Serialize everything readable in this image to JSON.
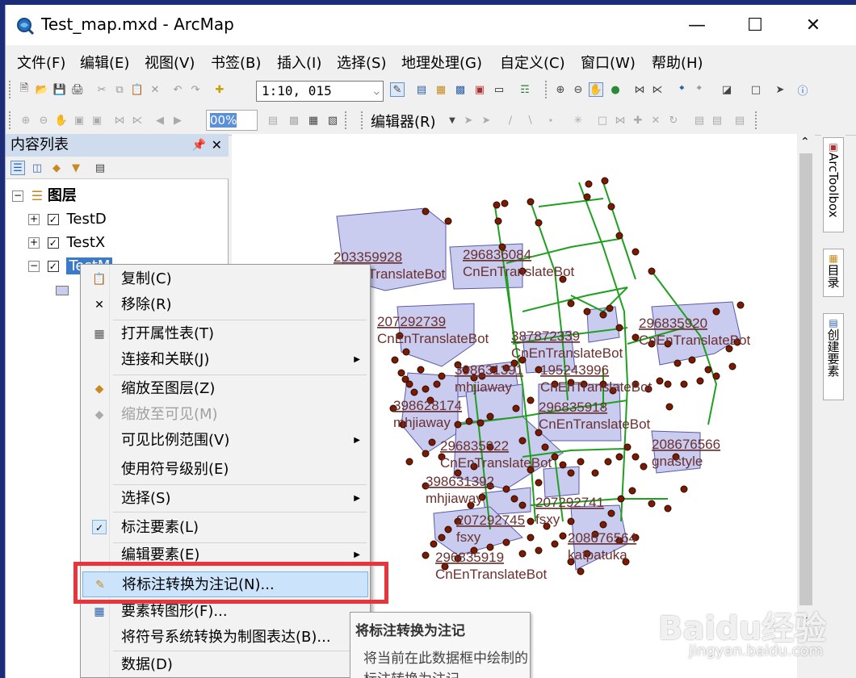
{
  "window": {
    "title": "Test_map.mxd - ArcMap"
  },
  "menubar": [
    "文件(F)",
    "编辑(E)",
    "视图(V)",
    "书签(B)",
    "插入(I)",
    "选择(S)",
    "地理处理(G)",
    "自定义(C)",
    "窗口(W)",
    "帮助(H)"
  ],
  "toolbar": {
    "scale": "1:10, 015",
    "zoom_percent": "00%",
    "editor_label": "编辑器(R)"
  },
  "toc": {
    "title": "内容列表",
    "root_label": "图层",
    "layers": [
      "TestD",
      "TestX",
      "TestM"
    ]
  },
  "side_tabs": [
    "ArcToolbox",
    "目录",
    "创建要素"
  ],
  "context_menu": {
    "items": [
      {
        "label": "复制(C)",
        "icon": "copy-icon"
      },
      {
        "label": "移除(R)",
        "icon": "remove-icon"
      },
      {
        "label": "打开属性表(T)",
        "icon": "table-icon"
      },
      {
        "label": "连接和关联(J)"
      },
      {
        "label": "缩放至图层(Z)",
        "icon": "zoom-layer-icon"
      },
      {
        "label": "缩放至可见(M)",
        "icon": "zoom-visible-icon"
      },
      {
        "label": "可见比例范围(V)"
      },
      {
        "label": "使用符号级别(E)"
      },
      {
        "label": "选择(S)"
      },
      {
        "label": "标注要素(L)",
        "icon": "check-icon"
      },
      {
        "label": "编辑要素(E)"
      },
      {
        "label": "将标注转换为注记(N)...",
        "icon": "convert-labels-icon"
      },
      {
        "label": "要素转图形(F)...",
        "icon": "feature-graphic-icon"
      },
      {
        "label": "将符号系统转换为制图表达(B)..."
      },
      {
        "label": "数据(D)"
      }
    ]
  },
  "tooltip": {
    "title": "将标注转换为注记",
    "body": "将当前在此数据框中绘制的标注转换为注记"
  },
  "map_labels": [
    {
      "id": "203359928",
      "name": "CnEnTranslateBot"
    },
    {
      "id": "296836084",
      "name": "CnEnTranslateBot"
    },
    {
      "id": "207292739",
      "name": "CnEnTranslateBot"
    },
    {
      "id": "387872339",
      "name": "CnEnTranslateBot"
    },
    {
      "id": "296835920",
      "name": "CnEnTranslateBot"
    },
    {
      "id": "398631391",
      "name": "mhjiaway"
    },
    {
      "id": "195243996",
      "name": "CnEnTranslateBot"
    },
    {
      "id": "398628174",
      "name": "mhjiaway"
    },
    {
      "id": "296835918",
      "name": "CnEnTranslateBot"
    },
    {
      "id": "208676566",
      "name": "gnastyle"
    },
    {
      "id": "296835922",
      "name": "CnEnTranslateBot"
    },
    {
      "id": "398631392",
      "name": "mhjiaway"
    },
    {
      "id": "207292741",
      "name": "fsxy"
    },
    {
      "id": "207292745",
      "name": "fsxy"
    },
    {
      "id": "208676564",
      "name": "katpatuka"
    },
    {
      "id": "296835919",
      "name": "CnEnTranslateBot"
    }
  ],
  "watermark": {
    "main": "Baidu经验",
    "sub": "jingyan.baidu.com"
  },
  "colors": {
    "polygon_fill": "#c9cbef",
    "road": "#1fa01f",
    "point": "#7a1a00",
    "label": "#6b3030",
    "highlight_box": "#e8343a"
  }
}
